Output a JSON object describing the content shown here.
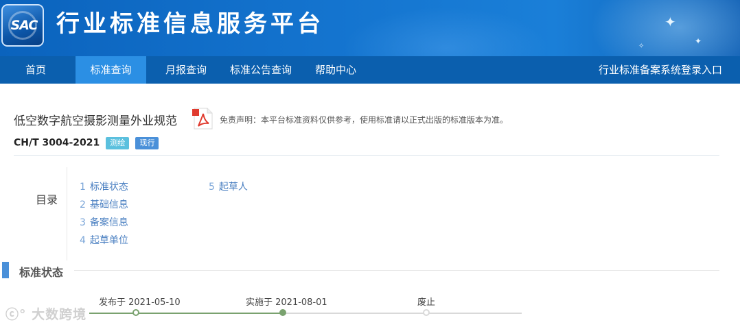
{
  "header": {
    "logo_text": "SAC",
    "site_title": "行业标准信息服务平台"
  },
  "nav": {
    "items": [
      {
        "label": "首页",
        "active": false
      },
      {
        "label": "标准查询",
        "active": true
      },
      {
        "label": "月报查询",
        "active": false
      },
      {
        "label": "标准公告查询",
        "active": false
      },
      {
        "label": "帮助中心",
        "active": false
      }
    ],
    "right_link": "行业标准备案系统登录入口"
  },
  "standard": {
    "title": "低空数字航空摄影测量外业规范",
    "code": "CH/T 3004-2021",
    "category_badge": "测绘",
    "status_badge": "现行",
    "disclaimer": "免责声明：本平台标准资料仅供参考，使用标准请以正式出版的标准版本为准。"
  },
  "toc": {
    "label": "目录",
    "items": [
      {
        "num": "1",
        "label": "标准状态"
      },
      {
        "num": "2",
        "label": "基础信息"
      },
      {
        "num": "3",
        "label": "备案信息"
      },
      {
        "num": "4",
        "label": "起草单位"
      },
      {
        "num": "5",
        "label": "起草人"
      }
    ]
  },
  "status_section": {
    "title": "标准状态",
    "timeline": [
      {
        "label": "发布于 2021-05-10",
        "state": "done"
      },
      {
        "label": "实施于 2021-08-01",
        "state": "current"
      },
      {
        "label": "废止",
        "state": "pending"
      }
    ]
  },
  "watermark": "大数跨境",
  "colors": {
    "nav_bg": "#0b5fae",
    "nav_active": "#2b8fe4",
    "timeline_done": "#7aa26f",
    "badge_category": "#5bc0de",
    "badge_status": "#4a90d9"
  }
}
